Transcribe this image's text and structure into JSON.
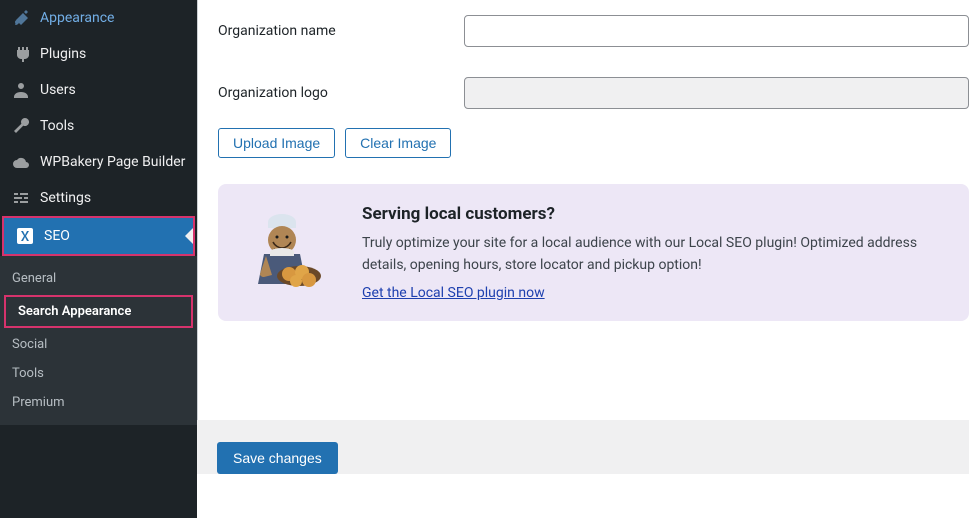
{
  "sidebar": {
    "items": [
      {
        "label": "Appearance",
        "icon": "appearance"
      },
      {
        "label": "Plugins",
        "icon": "plugins"
      },
      {
        "label": "Users",
        "icon": "users"
      },
      {
        "label": "Tools",
        "icon": "tools"
      },
      {
        "label": "WPBakery Page Builder",
        "icon": "wpbakery"
      },
      {
        "label": "Settings",
        "icon": "settings"
      },
      {
        "label": "SEO",
        "icon": "seo"
      }
    ],
    "submenu": [
      {
        "label": "General"
      },
      {
        "label": "Search Appearance"
      },
      {
        "label": "Social"
      },
      {
        "label": "Tools"
      },
      {
        "label": "Premium"
      }
    ]
  },
  "form": {
    "org_name_label": "Organization name",
    "org_logo_label": "Organization logo",
    "upload_btn": "Upload Image",
    "clear_btn": "Clear Image"
  },
  "promo": {
    "heading": "Serving local customers?",
    "desc": "Truly optimize your site for a local audience with our Local SEO plugin! Optimized address details, opening hours, store locator and pickup option!",
    "link": "Get the Local SEO plugin now"
  },
  "save_btn": "Save changes"
}
